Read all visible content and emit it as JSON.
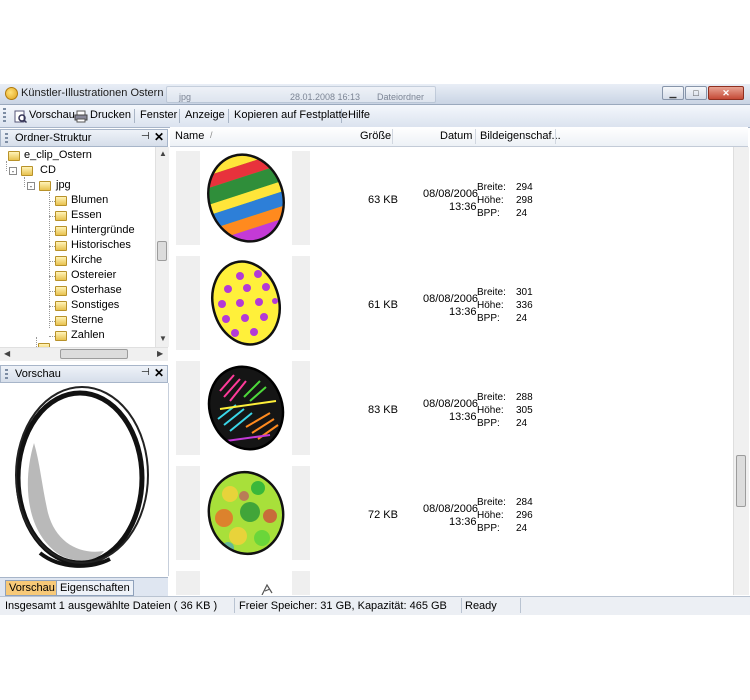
{
  "window": {
    "title": "Künstler-Illustrationen Ostern",
    "background_tabs": [
      "jpg",
      "28.01.2008 16:13",
      "Dateiordner"
    ],
    "buttons": {
      "minimize": "▁",
      "maximize": "□",
      "close": "✕"
    }
  },
  "toolbar": {
    "items": [
      "Vorschau",
      "Drucken",
      "Fenster",
      "Anzeige",
      "Kopieren auf Festplatte",
      "Hilfe"
    ]
  },
  "folder_panel": {
    "title": "Ordner-Struktur",
    "pin": "⊣",
    "close": "✕",
    "tree": [
      {
        "label": "e_clip_Ostern",
        "level": 0,
        "expander": "-"
      },
      {
        "label": "CD",
        "level": 1,
        "expander": "-"
      },
      {
        "label": "jpg",
        "level": 2,
        "expander": "-"
      },
      {
        "label": "Blumen",
        "level": 3
      },
      {
        "label": "Essen",
        "level": 3
      },
      {
        "label": "Hintergründe",
        "level": 3
      },
      {
        "label": "Historisches",
        "level": 3
      },
      {
        "label": "Kirche",
        "level": 3
      },
      {
        "label": "Ostereier",
        "level": 3
      },
      {
        "label": "Osterhase",
        "level": 3
      },
      {
        "label": "Sonstiges",
        "level": 3
      },
      {
        "label": "Sterne",
        "level": 3
      },
      {
        "label": "Zahlen",
        "level": 3
      }
    ]
  },
  "preview_panel": {
    "title": "Vorschau",
    "pin": "⊣",
    "close": "✕",
    "tabs": [
      "Vorschau",
      "Eigenschaften"
    ],
    "active_tab": "Vorschau"
  },
  "list": {
    "columns": {
      "name": "Name",
      "size": "Größe",
      "date": "Datum",
      "props": "Bildeigenschaf..."
    },
    "prop_labels": {
      "width": "Breite:",
      "height": "Höhe:",
      "bpp": "BPP:"
    },
    "rows": [
      {
        "thumb": "striped-easter-egg",
        "size": "63 KB",
        "date": "08/08/2006",
        "time": "13:36",
        "width": "294",
        "height": "298",
        "bpp": "24"
      },
      {
        "thumb": "dotted-easter-egg",
        "size": "61 KB",
        "date": "08/08/2006",
        "time": "13:36",
        "width": "301",
        "height": "336",
        "bpp": "24"
      },
      {
        "thumb": "dark-patterned-easter-egg",
        "size": "83 KB",
        "date": "08/08/2006",
        "time": "13:36",
        "width": "288",
        "height": "305",
        "bpp": "24"
      },
      {
        "thumb": "mottled-green-easter-egg",
        "size": "72 KB",
        "date": "08/08/2006",
        "time": "13:36",
        "width": "284",
        "height": "296",
        "bpp": "24"
      }
    ]
  },
  "statusbar": {
    "selection": "Insgesamt 1 ausgewählte Dateien ( 36 KB )",
    "storage": "Freier Speicher: 31 GB, Kapazität: 465 GB",
    "state": "Ready"
  },
  "colors": {
    "active_tab": "#f7c978",
    "folder": "#e8c24f",
    "window_bar": "#c9d4e4"
  }
}
